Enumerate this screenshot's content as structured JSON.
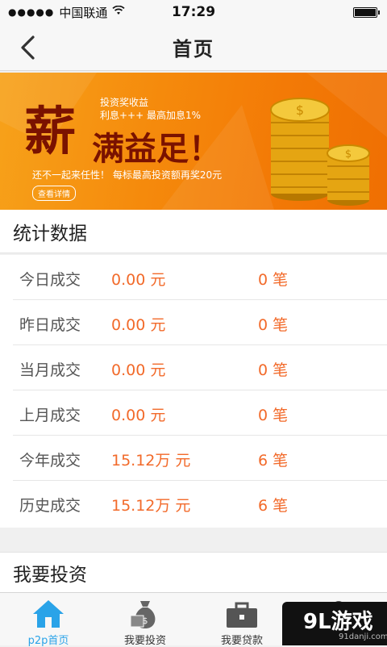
{
  "status_bar": {
    "signal": "●●●●●",
    "carrier": "中国联通",
    "time": "17:29"
  },
  "nav": {
    "title": "首页"
  },
  "banner": {
    "headline_big": "薪",
    "headline_rest": "满益足！",
    "tag": "投资奖收益",
    "sub": "利息+++  最高加息1%",
    "line": "还不一起来任性！  每标最高投资额再奖20元",
    "button": "查看详情"
  },
  "stats": {
    "title": "统计数据",
    "rows": [
      {
        "label": "今日成交",
        "amount": "0.00 元",
        "count": "0 笔"
      },
      {
        "label": "昨日成交",
        "amount": "0.00 元",
        "count": "0 笔"
      },
      {
        "label": "当月成交",
        "amount": "0.00 元",
        "count": "0 笔"
      },
      {
        "label": "上月成交",
        "amount": "0.00 元",
        "count": "0 笔"
      },
      {
        "label": "今年成交",
        "amount": "15.12万 元",
        "count": "6 笔"
      },
      {
        "label": "历史成交",
        "amount": "15.12万 元",
        "count": "6 笔"
      }
    ]
  },
  "invest": {
    "title": "我要投资"
  },
  "tabs": [
    {
      "label": "p2p首页",
      "icon": "home-icon",
      "active": true
    },
    {
      "label": "我要投资",
      "icon": "money-bag-icon",
      "active": false
    },
    {
      "label": "我要贷款",
      "icon": "briefcase-icon",
      "active": false
    },
    {
      "label": "",
      "icon": "user-icon",
      "active": false
    }
  ],
  "watermark": {
    "logo": "9L游戏",
    "url": "91danji.com"
  },
  "colors": {
    "accent": "#f26a2a",
    "active_tab": "#2aa3e8",
    "banner_orange": "#f58a0c",
    "banner_text_dark": "#7a1200"
  }
}
